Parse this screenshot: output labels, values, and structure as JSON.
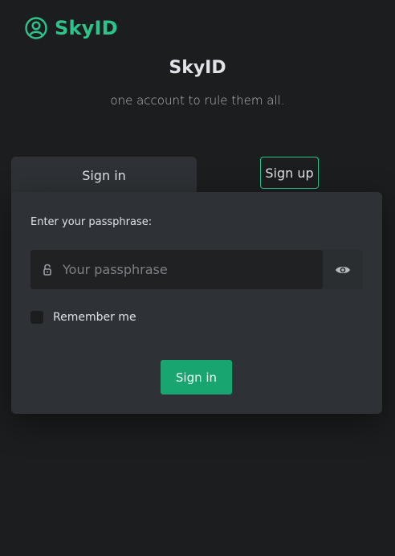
{
  "brand": {
    "name": "SkyID",
    "icon": "user-circle-icon",
    "color": "#2ec38a"
  },
  "hero": {
    "title": "SkyID",
    "subtitle": "one account to rule them all."
  },
  "tabs": {
    "signin_label": "Sign in",
    "signup_label": "Sign up"
  },
  "form": {
    "field_label": "Enter your passphrase:",
    "passphrase_value": "",
    "passphrase_placeholder": "Your passphrase",
    "lock_icon": "unlock-icon",
    "toggle_icon": "eye-icon",
    "remember_label": "Remember me",
    "remember_checked": false,
    "submit_label": "Sign in"
  },
  "colors": {
    "background": "#1b1d1f",
    "card": "#2e3135",
    "accent": "#18a56f"
  }
}
